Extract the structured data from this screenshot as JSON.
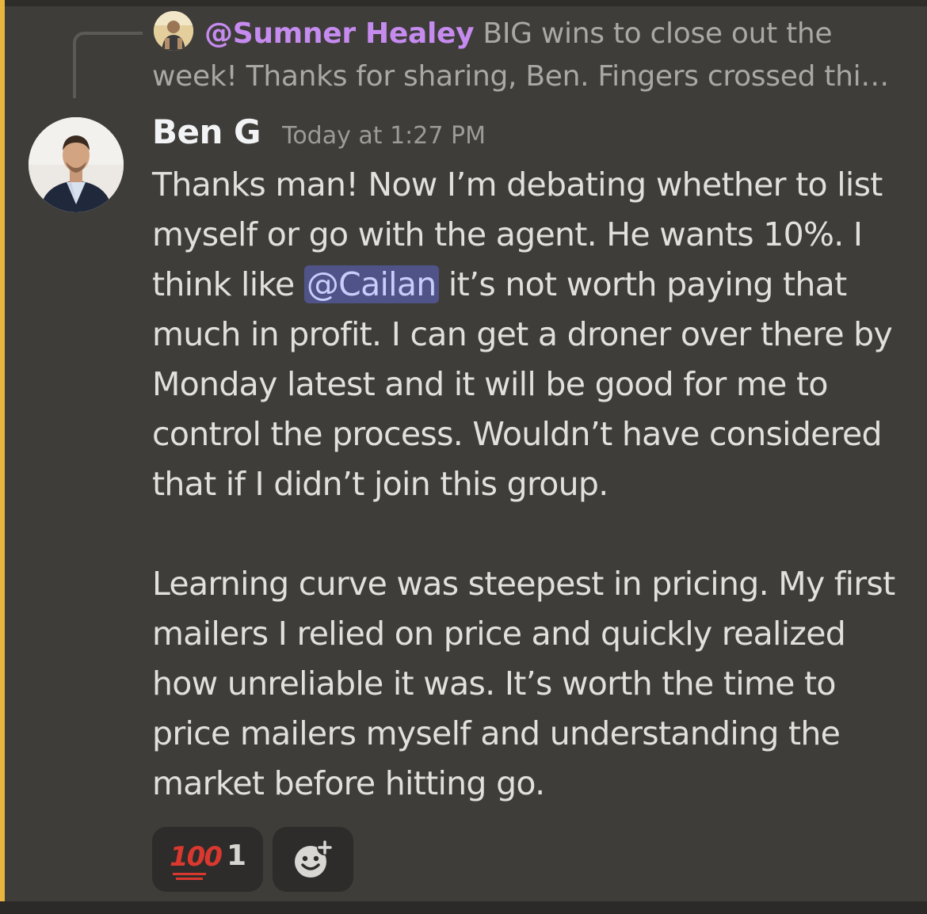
{
  "reply": {
    "author": "@Sumner Healey",
    "preview_line1": "BIG wins to close out the",
    "preview_line2": "week! Thanks for sharing, Ben.   Fingers crossed thi…"
  },
  "message": {
    "author": "Ben G",
    "timestamp": "Today at 1:27 PM",
    "paragraph1_before_mention": "Thanks man! Now I’m debating whether to list myself or go with the agent. He wants 10%. I think like ",
    "mention": "@Cailan",
    "paragraph1_after_mention": " it’s not worth paying that much in profit. I can get a droner over there by Monday latest and it will be good for me to control the process. Wouldn’t have considered that if I didn’t join this group.",
    "paragraph2": "Learning curve was steepest in pricing. My first mailers I relied on price and quickly realized how unreliable it was. It’s worth the time to price mailers myself and understanding the market before hitting go."
  },
  "reactions": [
    {
      "emoji": "100",
      "icon": "hundred-points-emoji",
      "count": "1"
    }
  ],
  "add_reaction": {
    "icon": "add-reaction-icon"
  },
  "colors": {
    "background": "#3f3d39",
    "highlight_bar": "#eab53f",
    "reply_author": "#c58bef",
    "mention_bg": "#4f5388",
    "mention_text": "#c9cdfb",
    "reaction_bg": "#2d2c2a",
    "emoji_red": "#d9382f"
  }
}
